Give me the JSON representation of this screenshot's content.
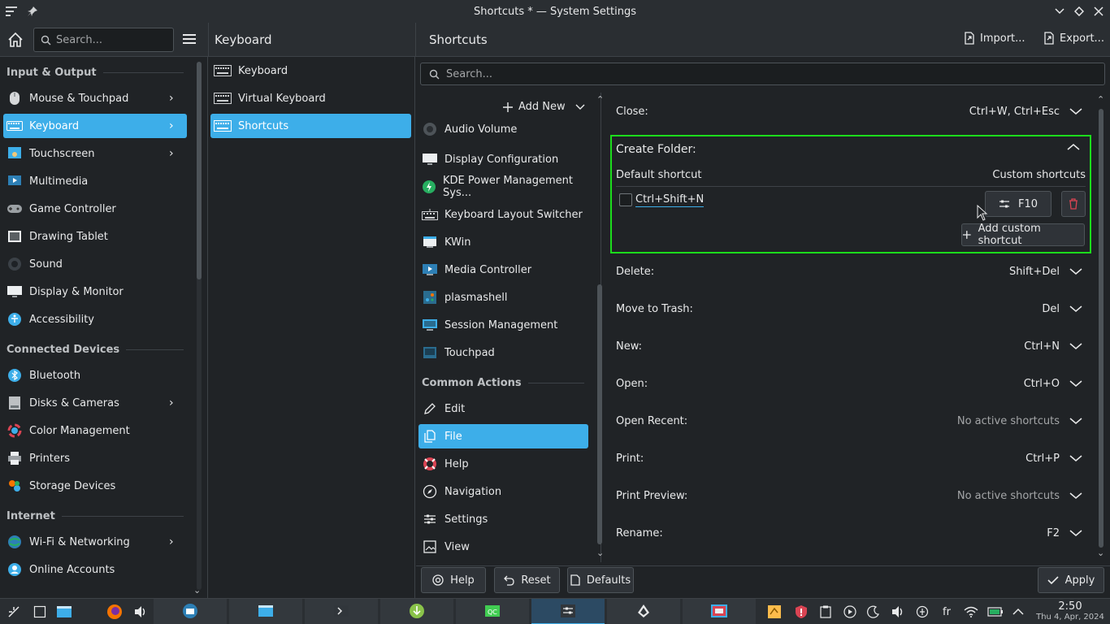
{
  "window": {
    "title": "Shortcuts * — System Settings"
  },
  "header": {
    "search_placeholder": "Search...",
    "column2_title": "Keyboard",
    "main_title": "Shortcuts",
    "import_label": "Import...",
    "export_label": "Export..."
  },
  "sidebar": {
    "sections": [
      {
        "label": "Input & Output"
      },
      {
        "label": "Connected Devices"
      },
      {
        "label": "Internet"
      }
    ],
    "items": [
      {
        "label": "Mouse & Touchpad",
        "icon": "mouse-icon",
        "chevron": true
      },
      {
        "label": "Keyboard",
        "icon": "keyboard-icon",
        "chevron": true,
        "active": true
      },
      {
        "label": "Touchscreen",
        "icon": "touchscreen-icon",
        "chevron": true
      },
      {
        "label": "Multimedia",
        "icon": "multimedia-icon"
      },
      {
        "label": "Game Controller",
        "icon": "gamepad-icon"
      },
      {
        "label": "Drawing Tablet",
        "icon": "tablet-icon"
      },
      {
        "label": "Sound",
        "icon": "speaker-icon"
      },
      {
        "label": "Display & Monitor",
        "icon": "monitor-icon"
      },
      {
        "label": "Accessibility",
        "icon": "accessibility-icon"
      },
      {
        "label": "Bluetooth",
        "icon": "bluetooth-icon"
      },
      {
        "label": "Disks & Cameras",
        "icon": "disk-icon",
        "chevron": true
      },
      {
        "label": "Color Management",
        "icon": "color-icon"
      },
      {
        "label": "Printers",
        "icon": "printer-icon"
      },
      {
        "label": "Storage Devices",
        "icon": "storage-icon"
      },
      {
        "label": "Wi-Fi & Networking",
        "icon": "wifi-globe-icon",
        "chevron": true
      },
      {
        "label": "Online Accounts",
        "icon": "online-accounts-icon"
      }
    ]
  },
  "column2": {
    "items": [
      {
        "label": "Keyboard"
      },
      {
        "label": "Virtual Keyboard"
      },
      {
        "label": "Shortcuts",
        "active": true
      }
    ]
  },
  "main": {
    "search_placeholder": "Search...",
    "add_new_label": "Add New",
    "categories": [
      {
        "label": "Audio Volume",
        "icon": "audio-volume-icon"
      },
      {
        "label": "Display Configuration",
        "icon": "display-icon"
      },
      {
        "label": "KDE Power Management Sys...",
        "icon": "power-icon"
      },
      {
        "label": "Keyboard Layout Switcher",
        "icon": "keyboard-layout-icon"
      },
      {
        "label": "KWin",
        "icon": "kwin-icon"
      },
      {
        "label": "Media Controller",
        "icon": "media-icon"
      },
      {
        "label": "plasmashell",
        "icon": "plasma-icon"
      },
      {
        "label": "Session Management",
        "icon": "session-icon"
      },
      {
        "label": "Touchpad",
        "icon": "touchpad-icon"
      }
    ],
    "common_section": "Common Actions",
    "common": [
      {
        "label": "Edit",
        "icon": "pencil-icon"
      },
      {
        "label": "File",
        "icon": "file-icon",
        "active": true
      },
      {
        "label": "Help",
        "icon": "lifebuoy-icon"
      },
      {
        "label": "Navigation",
        "icon": "compass-icon"
      },
      {
        "label": "Settings",
        "icon": "sliders-icon"
      },
      {
        "label": "View",
        "icon": "image-icon"
      }
    ],
    "shortcuts_before": [
      {
        "name": "Close:",
        "value": "Ctrl+W, Ctrl+Esc"
      }
    ],
    "expanded": {
      "name": "Create Folder:",
      "default_header": "Default shortcut",
      "custom_header": "Custom shortcuts",
      "default_value": "Ctrl+Shift+N",
      "custom_value": "F10",
      "add_custom_label": "Add custom shortcut"
    },
    "shortcuts_after": [
      {
        "name": "Delete:",
        "value": "Shift+Del"
      },
      {
        "name": "Move to Trash:",
        "value": "Del"
      },
      {
        "name": "New:",
        "value": "Ctrl+N"
      },
      {
        "name": "Open:",
        "value": "Ctrl+O"
      },
      {
        "name": "Open Recent:",
        "value": "No active shortcuts",
        "muted": true
      },
      {
        "name": "Print:",
        "value": "Ctrl+P"
      },
      {
        "name": "Print Preview:",
        "value": "No active shortcuts",
        "muted": true
      },
      {
        "name": "Rename:",
        "value": "F2"
      }
    ],
    "footer": {
      "help_label": "Help",
      "reset_label": "Reset",
      "defaults_label": "Defaults",
      "apply_label": "Apply"
    }
  },
  "taskbar": {
    "tray_lang": "fr",
    "time": "2:50",
    "date": "Thu 4, Apr, 2024"
  },
  "colors": {
    "accent": "#3daee9",
    "highlight_border": "#1cdc1c",
    "delete": "#da4453"
  }
}
